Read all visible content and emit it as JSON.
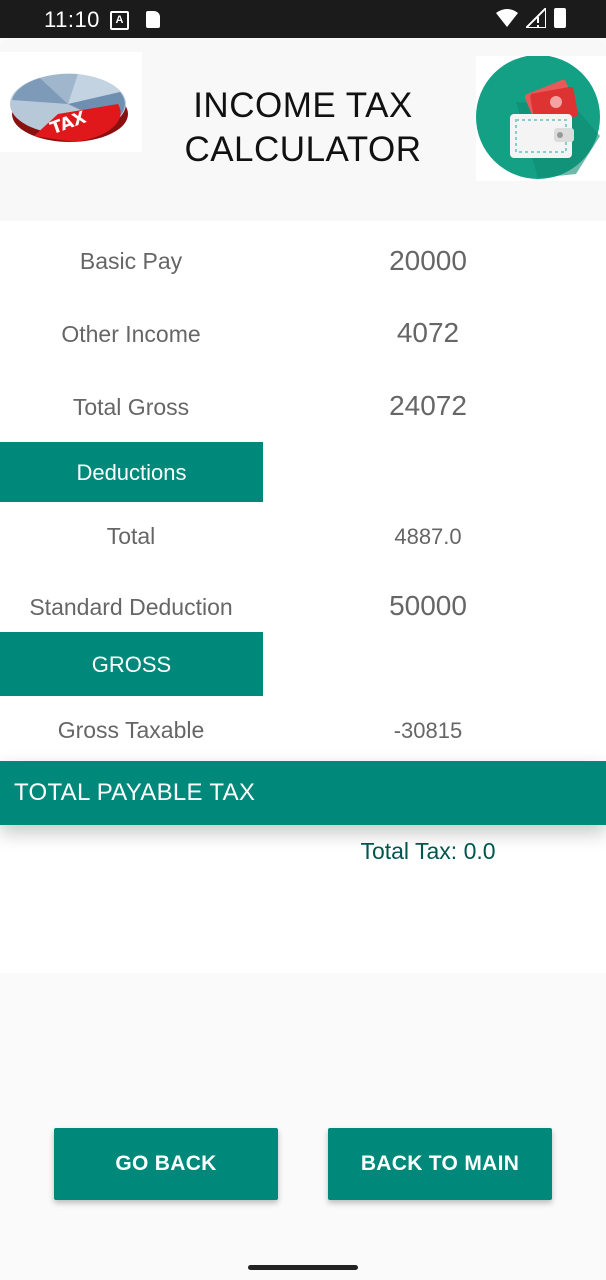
{
  "status_bar": {
    "time": "11:10",
    "a_icon": "A"
  },
  "header": {
    "title_line1": "INCOME TAX",
    "title_line2": "CALCULATOR",
    "left_logo_text": "TAX"
  },
  "income": {
    "basic_pay_label": "Basic Pay",
    "basic_pay_value": "20000",
    "other_income_label": "Other Income",
    "other_income_value": "4072",
    "total_gross_label": "Total Gross",
    "total_gross_value": "24072"
  },
  "deductions": {
    "section_label": "Deductions",
    "total_label": "Total",
    "total_value": "4887.0",
    "standard_label": "Standard Deduction",
    "standard_value": "50000"
  },
  "gross": {
    "section_label": "GROSS",
    "taxable_label": "Gross Taxable",
    "taxable_value": "-30815"
  },
  "payable": {
    "section_label": "TOTAL PAYABLE TAX",
    "total_tax_text": "Total Tax: 0.0"
  },
  "buttons": {
    "go_back": "GO BACK",
    "back_to_main": "BACK TO MAIN"
  },
  "colors": {
    "primary": "#00897b",
    "status_bar": "#1b1b1b"
  },
  "icons": [
    "wifi-icon",
    "signal-icon",
    "battery-icon",
    "tax-pie-chart-icon",
    "wallet-icon"
  ]
}
